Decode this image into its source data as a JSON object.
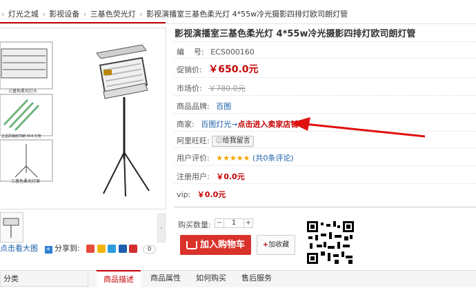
{
  "breadcrumb": [
    "灯光之城",
    "影视设备",
    "三基色荧光灯",
    "影视演播室三基色柔光灯  4*55w冷光摄影四排灯欧司朗灯管"
  ],
  "breadcrumb_sep": "›",
  "gallery": {
    "captions": [
      "三基色柔光灯头",
      "正品原装欧司朗 954 灯管",
      "三基色柔光灯架"
    ],
    "zoom_label": "点击看大图",
    "share_label": "分享到:",
    "share_count": "0"
  },
  "product": {
    "title": "影视演播室三基色柔光灯  4*55w冷光摄影四排灯欧司朗灯管",
    "sku_label": "编    号:",
    "sku": "ECS000160",
    "promo_label": "促销价:",
    "promo_price": "￥650.0元",
    "market_label": "市场价:",
    "market_price": "￥780.0元",
    "brand_label": "商品品牌:",
    "brand": "百图",
    "seller_label": "商家:",
    "seller_name": "百图灯光",
    "seller_arrow": "→",
    "seller_link": "点击进入卖家店铺",
    "wangwang_label": "阿里旺旺:",
    "wangwang_btn": "给我留言",
    "rating_label": "用户评价:",
    "rating_stars": "★★★★★",
    "rating_count": "(共0条评论)",
    "member_label": "注册用户:",
    "member_price": "￥0.0元",
    "vip_label": "vip:",
    "vip_price": "￥0.0元",
    "qty_label": "购买数量:",
    "qty_minus": "−",
    "qty_value": "1",
    "qty_plus": "+",
    "cart_btn": "加入购物车",
    "fav_btn": "加收藏"
  },
  "tabs": {
    "category": "分类",
    "items": [
      "商品描述",
      "商品属性",
      "如何购买",
      "售后服务"
    ]
  },
  "colors": {
    "accent": "#c40000",
    "link": "#1a5fa8",
    "cart": "#d9322b"
  }
}
